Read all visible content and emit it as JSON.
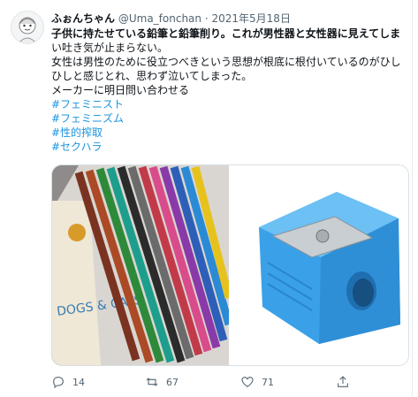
{
  "tweet": {
    "display_name": "ふぉんちゃん",
    "handle": "@Uma_fonchan",
    "separator": "·",
    "date": "2021年5月18日",
    "lines": [
      "子供に持たせている鉛筆と鉛筆削り。これが男性器と女性器に見えてしま",
      "い吐き気が止まらない。",
      "女性は男性のために役立つべきという思想が根底に根付いているのがひし",
      "ひしと感じとれ、思わず泣いてしまった。",
      "メーカーに明日問い合わせる"
    ],
    "hashtags": [
      "#フェミニスト",
      "#フェミニズム",
      "#性的搾取",
      "#セクハラ"
    ]
  },
  "images": [
    {
      "icon": "pencil-box-photo",
      "box_text": "DOGS & CATS"
    },
    {
      "icon": "pencil-sharpener-photo"
    }
  ],
  "actions": {
    "reply_count": "14",
    "retweet_count": "67",
    "like_count": "71"
  },
  "colors": {
    "link": "#1b95e0",
    "muted": "#536471",
    "sharpener": "#3aa1e8"
  }
}
